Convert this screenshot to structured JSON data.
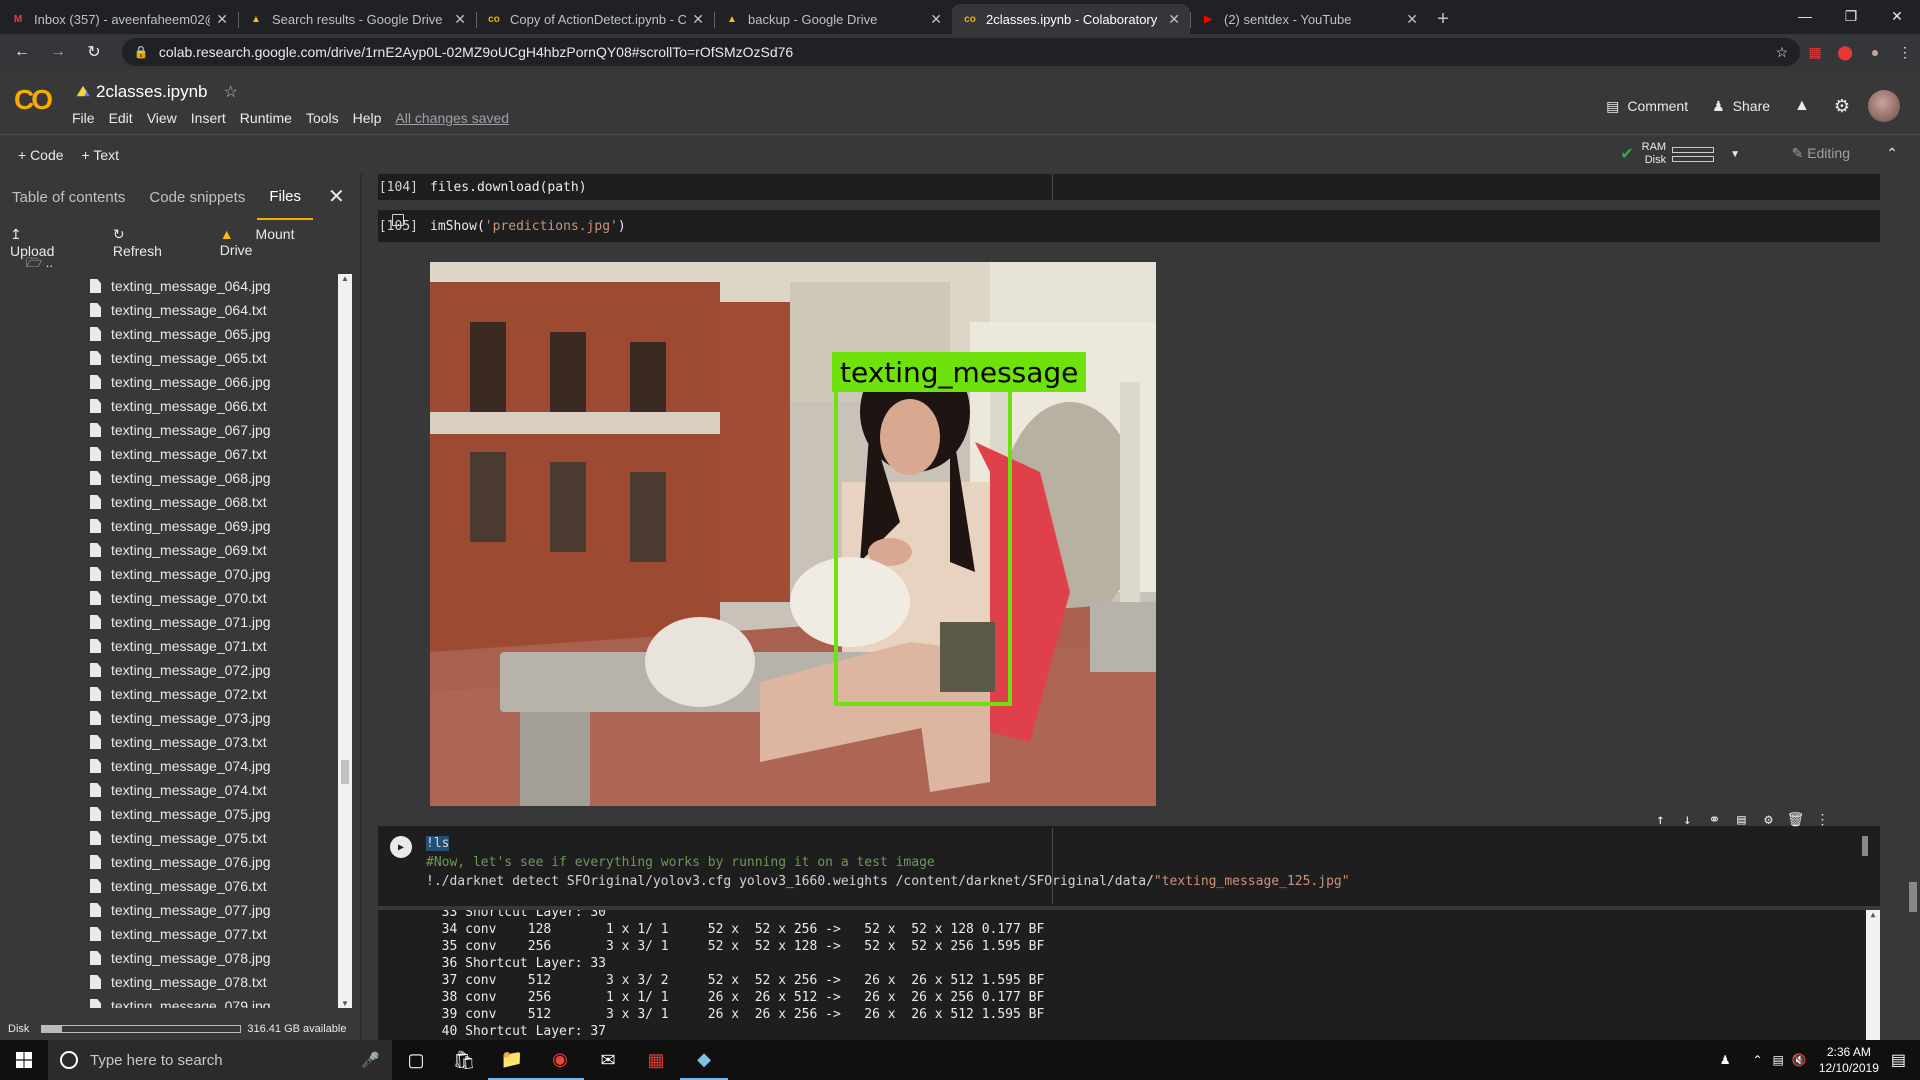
{
  "browser": {
    "tabs": [
      {
        "title": "Inbox (357) - aveenfaheem02@g",
        "fav": "M",
        "favcolor": "#ea4335"
      },
      {
        "title": "Search results - Google Drive",
        "fav": "▲",
        "favcolor": "#fbbc04"
      },
      {
        "title": "Copy of ActionDetect.ipynb - Co",
        "fav": "co",
        "favcolor": "#f9ab00"
      },
      {
        "title": "backup - Google Drive",
        "fav": "▲",
        "favcolor": "#fbbc04"
      },
      {
        "title": "2classes.ipynb - Colaboratory",
        "fav": "co",
        "favcolor": "#f9ab00",
        "active": true
      },
      {
        "title": "(2) sentdex - YouTube",
        "fav": "▶",
        "favcolor": "#ff0000"
      }
    ],
    "url": "colab.research.google.com/drive/1rnE2Ayp0L-02MZ9oUCgH4hbzPornQY08#scrollTo=rOfSMzOzSd76"
  },
  "colab": {
    "logo": "CO",
    "notebook_name": "2classes.ipynb",
    "menu": [
      "File",
      "Edit",
      "View",
      "Insert",
      "Runtime",
      "Tools",
      "Help"
    ],
    "save_status": "All changes saved",
    "comment_label": "Comment",
    "share_label": "Share",
    "add_code": "+ Code",
    "add_text": "+ Text",
    "ram_label": "RAM",
    "disk_label": "Disk",
    "editing_label": "Editing"
  },
  "sidepanel": {
    "tabs": [
      "Table of contents",
      "Code snippets",
      "Files"
    ],
    "upload": "Upload",
    "refresh": "Refresh",
    "mount": "Mount Drive",
    "parent": "..",
    "files": [
      "texting_message_064.jpg",
      "texting_message_064.txt",
      "texting_message_065.jpg",
      "texting_message_065.txt",
      "texting_message_066.jpg",
      "texting_message_066.txt",
      "texting_message_067.jpg",
      "texting_message_067.txt",
      "texting_message_068.jpg",
      "texting_message_068.txt",
      "texting_message_069.jpg",
      "texting_message_069.txt",
      "texting_message_070.jpg",
      "texting_message_070.txt",
      "texting_message_071.jpg",
      "texting_message_071.txt",
      "texting_message_072.jpg",
      "texting_message_072.txt",
      "texting_message_073.jpg",
      "texting_message_073.txt",
      "texting_message_074.jpg",
      "texting_message_074.txt",
      "texting_message_075.jpg",
      "texting_message_075.txt",
      "texting_message_076.jpg",
      "texting_message_076.txt",
      "texting_message_077.jpg",
      "texting_message_077.txt",
      "texting_message_078.jpg",
      "texting_message_078.txt",
      "texting_message_079.jpg"
    ],
    "disk_label": "Disk",
    "disk_available": "316.41 GB available",
    "disk_used_fraction": 0.1
  },
  "cells": {
    "c1_num": "[104]",
    "c1_code": "files.download(path)",
    "c2_num": "[105]",
    "c2_fn": "imShow(",
    "c2_arg": "'predictions.jpg'",
    "c2_close": ")",
    "detection_label": "texting_message",
    "c3_line1": "!ls",
    "c3_line2": "#Now, let's see if everything works by running it on a test image",
    "c3_line3_cmd": "!./darknet detect SFOriginal/yolov3.cfg yolov3_1660.weights /content/darknet/SFOriginal/data/",
    "c3_line3_str": "\"texting_message_125.jpg\"",
    "output_lines": [
      "  33 Shortcut Layer: 30",
      "  34 conv    128       1 x 1/ 1     52 x  52 x 256 ->   52 x  52 x 128 0.177 BF",
      "  35 conv    256       3 x 3/ 1     52 x  52 x 128 ->   52 x  52 x 256 1.595 BF",
      "  36 Shortcut Layer: 33",
      "  37 conv    512       3 x 3/ 2     52 x  52 x 256 ->   26 x  26 x 512 1.595 BF",
      "  38 conv    256       1 x 1/ 1     26 x  26 x 512 ->   26 x  26 x 256 0.177 BF",
      "  39 conv    512       3 x 3/ 1     26 x  26 x 256 ->   26 x  26 x 512 1.595 BF",
      "  40 Shortcut Layer: 37"
    ]
  },
  "taskbar": {
    "search_placeholder": "Type here to search",
    "time": "2:36 AM",
    "date": "12/10/2019"
  }
}
